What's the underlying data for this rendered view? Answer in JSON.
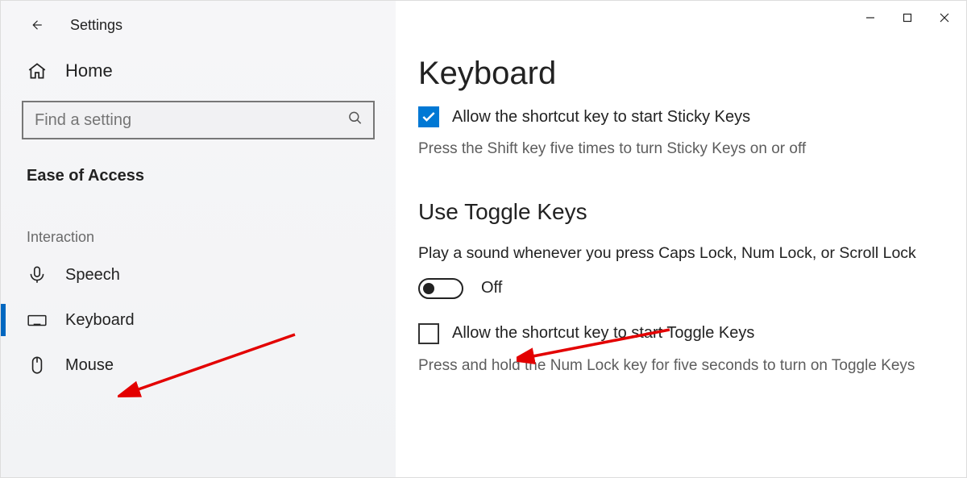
{
  "header": {
    "title": "Settings"
  },
  "sidebar": {
    "home_label": "Home",
    "search_placeholder": "Find a setting",
    "category": "Ease of Access",
    "group_label": "Interaction",
    "items": [
      {
        "label": "Speech"
      },
      {
        "label": "Keyboard"
      },
      {
        "label": "Mouse"
      }
    ]
  },
  "content": {
    "page_title": "Keyboard",
    "sticky_keys": {
      "checkbox_label": "Allow the shortcut key to start Sticky Keys",
      "checked": true,
      "subtext": "Press the Shift key five times to turn Sticky Keys on or off"
    },
    "toggle_keys": {
      "section_title": "Use Toggle Keys",
      "description": "Play a sound whenever you press Caps Lock, Num Lock, or Scroll Lock",
      "toggle_state": "Off",
      "shortcut_checkbox_label": "Allow the shortcut key to start Toggle Keys",
      "shortcut_checked": false,
      "shortcut_subtext": "Press and hold the Num Lock key for five seconds to turn on Toggle Keys"
    }
  },
  "colors": {
    "accent": "#0078d4"
  },
  "annotations": {
    "arrows": [
      "points-to-keyboard-nav",
      "points-to-toggle-off"
    ]
  }
}
